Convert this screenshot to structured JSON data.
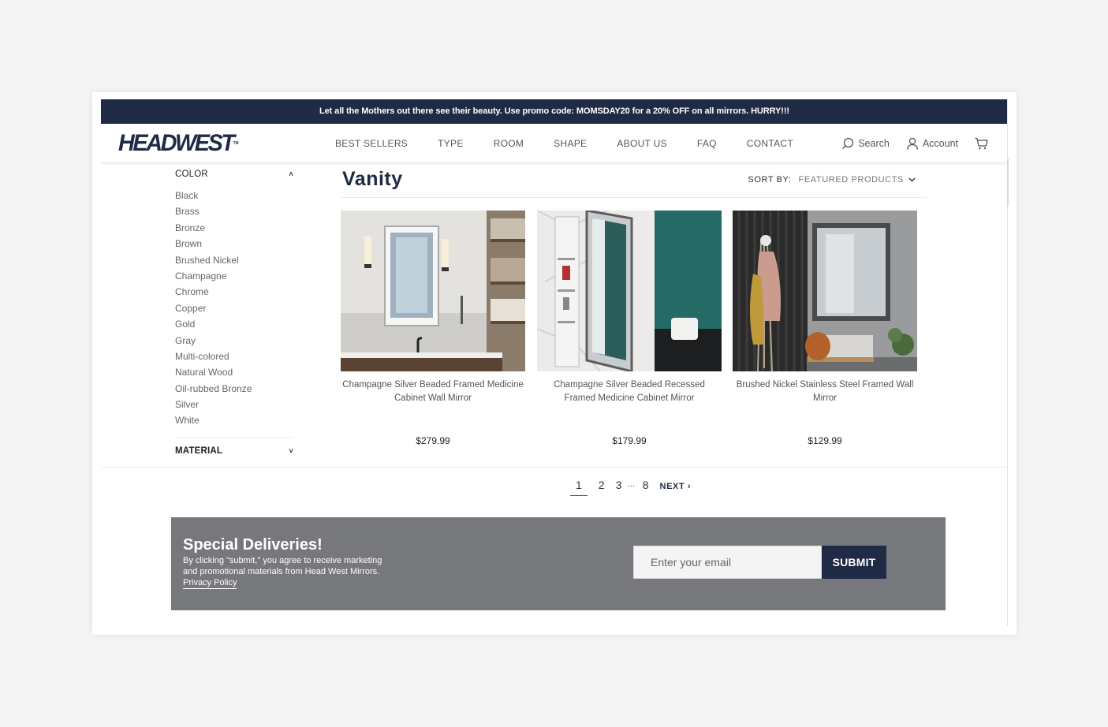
{
  "promo": {
    "text": "Let all the Mothers out there see their beauty. Use promo code: MOMSDAY20 for a 20% OFF on all mirrors. HURRY!!!"
  },
  "header": {
    "logo": "HEADWEST",
    "logo_tm": "TM",
    "nav": [
      "BEST SELLERS",
      "TYPE",
      "ROOM",
      "SHAPE",
      "ABOUT US",
      "FAQ",
      "CONTACT"
    ],
    "search_label": "Search",
    "account_label": "Account"
  },
  "sidebar": {
    "color_heading": "COLOR",
    "colors": [
      "Black",
      "Brass",
      "Bronze",
      "Brown",
      "Brushed Nickel",
      "Champagne",
      "Chrome",
      "Copper",
      "Gold",
      "Gray",
      "Multi-colored",
      "Natural Wood",
      "Oil-rubbed Bronze",
      "Silver",
      "White"
    ],
    "material_heading": "MATERIAL"
  },
  "main": {
    "title": "Vanity",
    "sort_label": "SORT BY:",
    "sort_value": "FEATURED PRODUCTS"
  },
  "products": [
    {
      "name": "Champagne Silver Beaded Framed Medicine Cabinet Wall Mirror",
      "price": "$279.99"
    },
    {
      "name": "Champagne Silver Beaded Recessed Framed Medicine Cabinet Mirror",
      "price": "$179.99"
    },
    {
      "name": "Brushed Nickel Stainless Steel Framed Wall Mirror",
      "price": "$129.99"
    }
  ],
  "pagination": {
    "pages": [
      "1",
      "2",
      "3",
      "...",
      "8"
    ],
    "next": "NEXT ›"
  },
  "newsletter": {
    "title": "Special Deliveries!",
    "text": "By clicking \"submit,\" you agree to receive marketing and promotional materials from Head West Mirrors.",
    "link": "Privacy Policy",
    "placeholder": "Enter your email",
    "submit": "SUBMIT"
  },
  "colors": {
    "navy": "#1f2a44",
    "newsletter_bg": "#77787c"
  }
}
